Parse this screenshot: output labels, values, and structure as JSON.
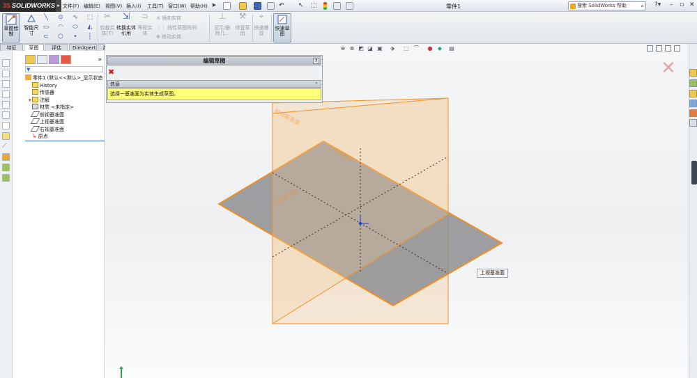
{
  "app": {
    "logo_text": "SOLIDWORKS",
    "document_title": "零件1",
    "help_search_placeholder": "搜索 SolidWorks 帮助"
  },
  "menu": [
    "文件(F)",
    "编辑(E)",
    "视图(V)",
    "插入(I)",
    "工具(T)",
    "窗口(W)",
    "帮助(H)"
  ],
  "commands": {
    "sketch": "草图绘制",
    "smart_dimension": "智能尺寸",
    "trim_entities": "剪裁实体(T)",
    "convert_entities": "转换实体引用",
    "offset_entities": "等距实体",
    "mirror_entities": "镜向实体",
    "linear_pattern": "线性草图阵列",
    "move_entities": "移动实体",
    "display_delete_relations": "显示/删除几...",
    "repair_sketch": "修复草图",
    "quick_snaps": "快速捕捉",
    "rapid_sketch": "快速草图"
  },
  "tabs": [
    "特征",
    "草图",
    "评估",
    "DimXpert",
    "办公室产品"
  ],
  "active_tab_index": 1,
  "tree": {
    "root": "零件1 (默认<<默认>_显示状态",
    "items": [
      "History",
      "传感器",
      "注解",
      "材质 <未指定>",
      "前视基准面",
      "上视基准面",
      "右视基准面",
      "原点"
    ]
  },
  "edit_panel": {
    "title": "编辑草图",
    "help": "?",
    "info_header": "信息",
    "info_text": "选择一基准面为实体生成草图。"
  },
  "graphics": {
    "tooltip": "上视基准面",
    "plane_labels": [
      "前视基准面",
      "上视基准面",
      "右视基准面"
    ],
    "plane_color": "#f0902a",
    "top_plane_fill": "#8e8f92"
  }
}
